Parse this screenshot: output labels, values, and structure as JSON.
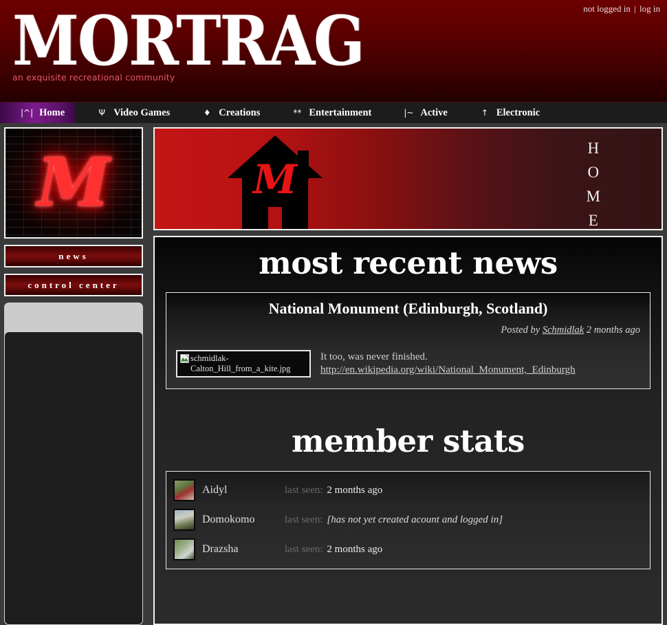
{
  "header": {
    "status_text": "not logged in",
    "separator": "|",
    "login_label": "log in",
    "logo_text": "MORTRAG",
    "tagline": "an exquisite recreational community"
  },
  "nav": {
    "items": [
      {
        "icon": "|^|",
        "label": "Home",
        "active": true
      },
      {
        "icon": "Ψ",
        "label": "Video Games",
        "active": false
      },
      {
        "icon": "♦",
        "label": "Creations",
        "active": false
      },
      {
        "icon": "**",
        "label": "Entertainment",
        "active": false
      },
      {
        "icon": "|~",
        "label": "Active",
        "active": false
      },
      {
        "icon": "↑",
        "label": "Electronic",
        "active": false
      }
    ]
  },
  "sidebar": {
    "neon_sign_alt": "mortrag-neon-monogram",
    "monogram_glyph": "M",
    "buttons": [
      {
        "label": "news"
      },
      {
        "label": "control center"
      }
    ]
  },
  "banner": {
    "house_alt": "black-house-silhouette",
    "vertical_label_lines": [
      "H",
      "O",
      "M",
      "E"
    ]
  },
  "news": {
    "section_title": "most recent news",
    "post": {
      "title": "National Monument (Edinburgh, Scotland)",
      "posted_by_prefix": "Posted by",
      "author": "Schmidlak",
      "time_ago": "2 months ago",
      "image_alt": "schmidlak-Calton_Hill_from_a_kite.jpg",
      "body_line": "It too, was never finished.",
      "link_text": "http://en.wikipedia.org/wiki/National_Monument,_Edinburgh"
    }
  },
  "members": {
    "section_title": "member stats",
    "seen_label": "last seen:",
    "rows": [
      {
        "name": "Aidyl",
        "last_seen": "2 months ago",
        "italic": false
      },
      {
        "name": "Domokomo",
        "last_seen": "[has not yet created acount and logged in]",
        "italic": true
      },
      {
        "name": "Drazsha",
        "last_seen": "2 months ago",
        "italic": false
      }
    ]
  },
  "colors": {
    "header_red": "#6d0000",
    "accent_pink": "#e8566a",
    "nav_active_purple": "#7d1a8e",
    "button_red": "#7a0d0d",
    "page_bg": "#3a3a3a"
  }
}
